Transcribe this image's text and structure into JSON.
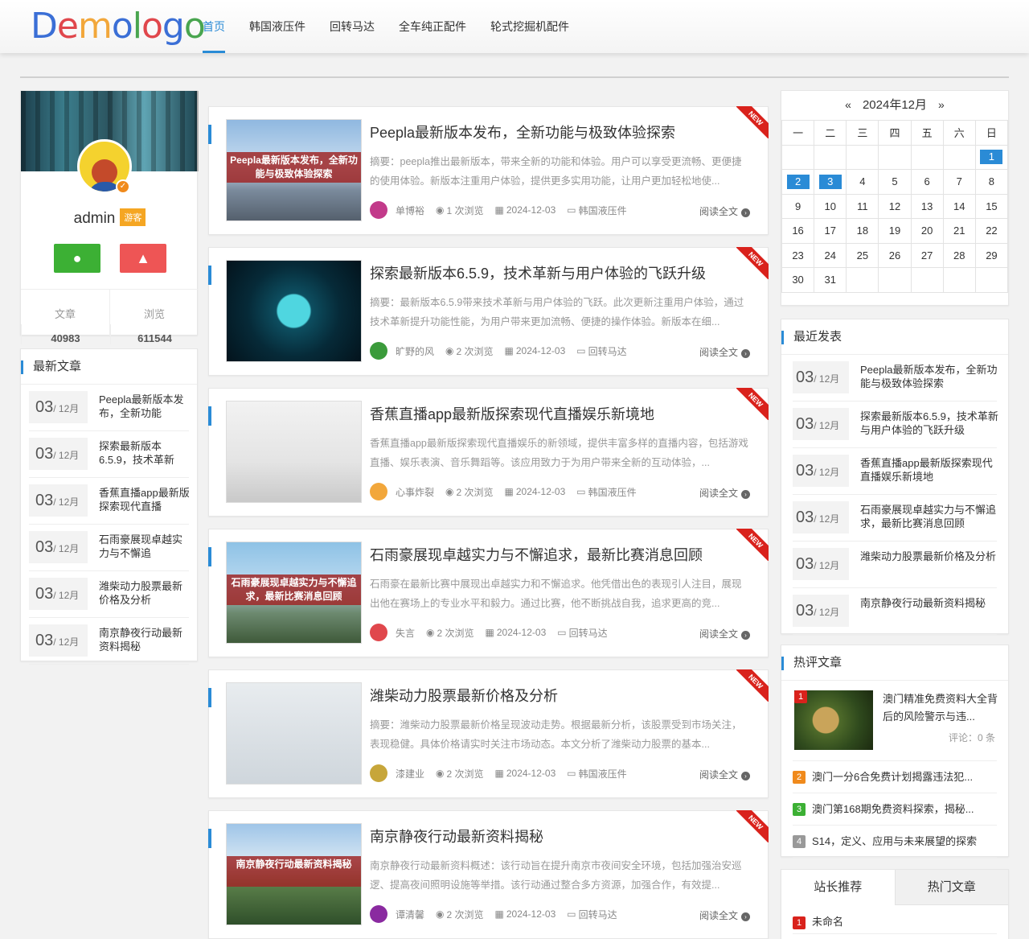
{
  "logo": {
    "letters": [
      "D",
      "e",
      "m",
      "o",
      "l",
      "o",
      "g",
      "o"
    ]
  },
  "nav": {
    "items": [
      "首页",
      "韩国液压件",
      "回转马达",
      "全车纯正配件",
      "轮式挖掘机配件"
    ]
  },
  "profile": {
    "name": "admin",
    "role": "游客",
    "stats": [
      {
        "label": "文章",
        "value": "40983"
      },
      {
        "label": "浏览",
        "value": "611544"
      }
    ]
  },
  "latest": {
    "title": "最新文章",
    "month": "/ 12月",
    "items": [
      {
        "day": "03",
        "title": "Peepla最新版本发布，全新功能"
      },
      {
        "day": "03",
        "title": "探索最新版本6.5.9，技术革新"
      },
      {
        "day": "03",
        "title": "香蕉直播app最新版探索现代直播"
      },
      {
        "day": "03",
        "title": "石雨豪展现卓越实力与不懈追"
      },
      {
        "day": "03",
        "title": "潍柴动力股票最新价格及分析"
      },
      {
        "day": "03",
        "title": "南京静夜行动最新资料揭秘"
      }
    ]
  },
  "articles": [
    {
      "title": "Peepla最新版本发布，全新功能与极致体验探索",
      "summary": "摘要：peepla推出最新版本，带来全新的功能和体验。用户可以享受更流畅、更便捷的使用体验。新版本注重用户体验，提供更多实用功能，让用户更加轻松地使...",
      "author": "单博裕",
      "views": "1 次浏览",
      "date": "2024-12-03",
      "category": "韩国液压件",
      "caption": "Peepla最新版本发布，全新功能与极致体验探索",
      "ribbon": "NEW",
      "more": "阅读全文"
    },
    {
      "title": "探索最新版本6.5.9，技术革新与用户体验的飞跃升级",
      "summary": "摘要：最新版本6.5.9带来技术革新与用户体验的飞跃。此次更新注重用户体验，通过技术革新提升功能性能，为用户带来更加流畅、便捷的操作体验。新版本在细...",
      "author": "旷野的风",
      "views": "2 次浏览",
      "date": "2024-12-03",
      "category": "回转马达",
      "caption": "",
      "ribbon": "NEW",
      "more": "阅读全文"
    },
    {
      "title": "香蕉直播app最新版探索现代直播娱乐新境地",
      "summary": "香蕉直播app最新版探索现代直播娱乐的新领域，提供丰富多样的直播内容，包括游戏直播、娱乐表演、音乐舞蹈等。该应用致力于为用户带来全新的互动体验，...",
      "author": "心事炸裂",
      "views": "2 次浏览",
      "date": "2024-12-03",
      "category": "韩国液压件",
      "caption": "",
      "ribbon": "NEW",
      "more": "阅读全文"
    },
    {
      "title": "石雨豪展现卓越实力与不懈追求，最新比赛消息回顾",
      "summary": "石雨豪在最新比赛中展现出卓越实力和不懈追求。他凭借出色的表现引人注目，展现出他在赛场上的专业水平和毅力。通过比赛，他不断挑战自我，追求更高的竞...",
      "author": "失言",
      "views": "2 次浏览",
      "date": "2024-12-03",
      "category": "回转马达",
      "caption": "石雨豪展现卓越实力与不懈追求，最新比赛消息回顾",
      "ribbon": "NEW",
      "more": "阅读全文"
    },
    {
      "title": "潍柴动力股票最新价格及分析",
      "summary": "摘要：潍柴动力股票最新价格呈现波动走势。根据最新分析，该股票受到市场关注，表现稳健。具体价格请实时关注市场动态。本文分析了潍柴动力股票的基本...",
      "author": "漆建业",
      "views": "2 次浏览",
      "date": "2024-12-03",
      "category": "韩国液压件",
      "caption": "",
      "ribbon": "NEW",
      "more": "阅读全文"
    },
    {
      "title": "南京静夜行动最新资料揭秘",
      "summary": "南京静夜行动最新资料概述：该行动旨在提升南京市夜间安全环境，包括加强治安巡逻、提高夜间照明设施等举措。该行动通过整合多方资源，加强合作，有效提...",
      "author": "谭清馨",
      "views": "2 次浏览",
      "date": "2024-12-03",
      "category": "回转马达",
      "caption": "南京静夜行动最新资料揭秘",
      "ribbon": "NEW",
      "more": "阅读全文"
    }
  ],
  "calendar": {
    "prev": "«",
    "month": "2024年12月",
    "next": "»",
    "weekdays": [
      "一",
      "二",
      "三",
      "四",
      "五",
      "六",
      "日"
    ],
    "rows": [
      [
        "",
        "",
        "",
        "",
        "",
        "",
        "1"
      ],
      [
        "2",
        "3",
        "4",
        "5",
        "6",
        "7",
        "8"
      ],
      [
        "9",
        "10",
        "11",
        "12",
        "13",
        "14",
        "15"
      ],
      [
        "16",
        "17",
        "18",
        "19",
        "20",
        "21",
        "22"
      ],
      [
        "23",
        "24",
        "25",
        "26",
        "27",
        "28",
        "29"
      ],
      [
        "30",
        "31",
        "",
        "",
        "",
        "",
        ""
      ]
    ],
    "highlighted": [
      "1",
      "2",
      "3"
    ]
  },
  "recent": {
    "title": "最近发表",
    "month": "/ 12月",
    "items": [
      {
        "day": "03",
        "title": "Peepla最新版本发布，全新功能与极致体验探索"
      },
      {
        "day": "03",
        "title": "探索最新版本6.5.9，技术革新与用户体验的飞跃升级"
      },
      {
        "day": "03",
        "title": "香蕉直播app最新版探索现代直播娱乐新境地"
      },
      {
        "day": "03",
        "title": "石雨豪展现卓越实力与不懈追求，最新比赛消息回顾"
      },
      {
        "day": "03",
        "title": "潍柴动力股票最新价格及分析"
      },
      {
        "day": "03",
        "title": "南京静夜行动最新资料揭秘"
      }
    ]
  },
  "hot": {
    "title": "热评文章",
    "first": {
      "num": "1",
      "title": "澳门精准免费资料大全背后的风险警示与违...",
      "comments": "评论：0 条"
    },
    "items": [
      {
        "num": "2",
        "title": "澳门一分6合免费计划揭露违法犯...",
        "color": "#f08a1c"
      },
      {
        "num": "3",
        "title": "澳门第168期免费资料探索，揭秘...",
        "color": "#3cb034"
      },
      {
        "num": "4",
        "title": "S14，定义、应用与未来展望的探索",
        "color": "#999999"
      }
    ]
  },
  "tabs": {
    "labels": [
      "站长推荐",
      "热门文章"
    ],
    "first_item": {
      "num": "1",
      "title": "未命名"
    }
  }
}
